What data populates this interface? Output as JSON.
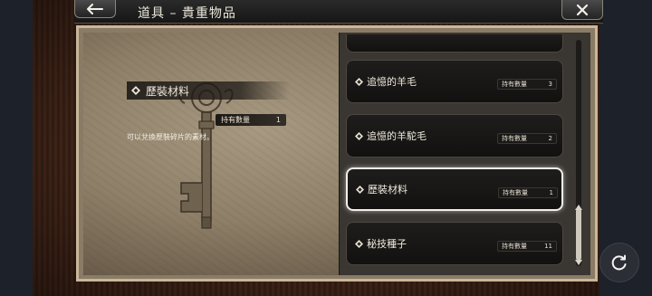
{
  "header": {
    "title": "道具 – 貴重物品"
  },
  "detail": {
    "item_name": "歷裝材料",
    "qty_label": "持有數量",
    "qty_value": "1",
    "description": "可以兌換歷裝碎片的素材。"
  },
  "list": {
    "items": [
      {
        "label": "追憶的羊毛",
        "qty_label": "持有數量",
        "qty": "3"
      },
      {
        "label": "追憶的羊駝毛",
        "qty_label": "持有數量",
        "qty": "2"
      },
      {
        "label": "歷裝材料",
        "qty_label": "持有數量",
        "qty": "1"
      },
      {
        "label": "秘技種子",
        "qty_label": "持有數量",
        "qty": "11"
      }
    ],
    "selected_index": 2
  },
  "icons": {
    "back": "back-arrow-icon",
    "close": "close-icon",
    "item_marker": "diamond-icon",
    "refresh": "refresh-icon",
    "scroll_up": "chevron-up-icon",
    "scroll_down": "chevron-down-icon"
  },
  "colors": {
    "frame_wood": "#4a2a1c",
    "parchment": "#8e7f68",
    "selected_border": "#f2efe8"
  }
}
